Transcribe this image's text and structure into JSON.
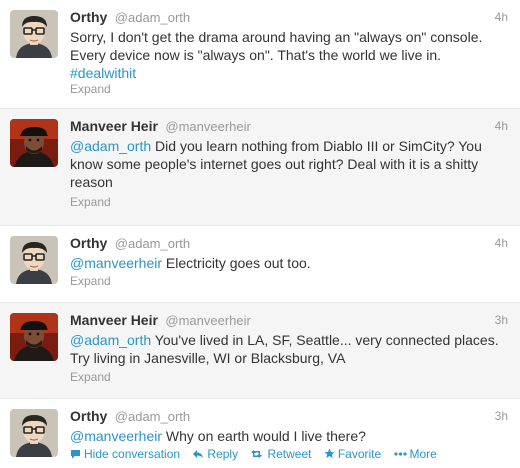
{
  "tweets": [
    {
      "fullname": "Orthy",
      "username": "@adam_orth",
      "time": "4h",
      "text": "Sorry, I don't get the drama around having an \"always on\" console. Every device now is \"always on\". That's the world we live in.",
      "hashtag": "#dealwithit",
      "expand": "Expand"
    },
    {
      "fullname": "Manveer Heir",
      "username": "@manveerheir",
      "time": "4h",
      "mention": "@adam_orth",
      "text": " Did you learn nothing from Diablo III or SimCity? You know some people's internet goes out right? Deal with it is a shitty reason",
      "expand": "Expand"
    },
    {
      "fullname": "Orthy",
      "username": "@adam_orth",
      "time": "4h",
      "mention": "@manveerheir",
      "text": " Electricity goes out too.",
      "expand": "Expand"
    },
    {
      "fullname": "Manveer Heir",
      "username": "@manveerheir",
      "time": "3h",
      "mention": "@adam_orth",
      "text": " You've lived in LA, SF, Seattle... very connected places. Try living in Janesville, WI or Blacksburg, VA",
      "expand": "Expand"
    },
    {
      "fullname": "Orthy",
      "username": "@adam_orth",
      "time": "3h",
      "mention": "@manveerheir",
      "text": " Why on earth would I live there?"
    }
  ],
  "actions": {
    "hide_conversation": "Hide conversation",
    "reply": "Reply",
    "retweet": "Retweet",
    "favorite": "Favorite",
    "more": "More"
  },
  "icons": {
    "hide_conversation": "speech-bubble-icon",
    "reply": "reply-arrow-icon",
    "retweet": "retweet-icon",
    "favorite": "star-icon",
    "more": "dots-icon"
  },
  "colors": {
    "link": "#2a95c9",
    "muted": "#999999",
    "text": "#333333",
    "alt_row": "#f5f5f5"
  }
}
